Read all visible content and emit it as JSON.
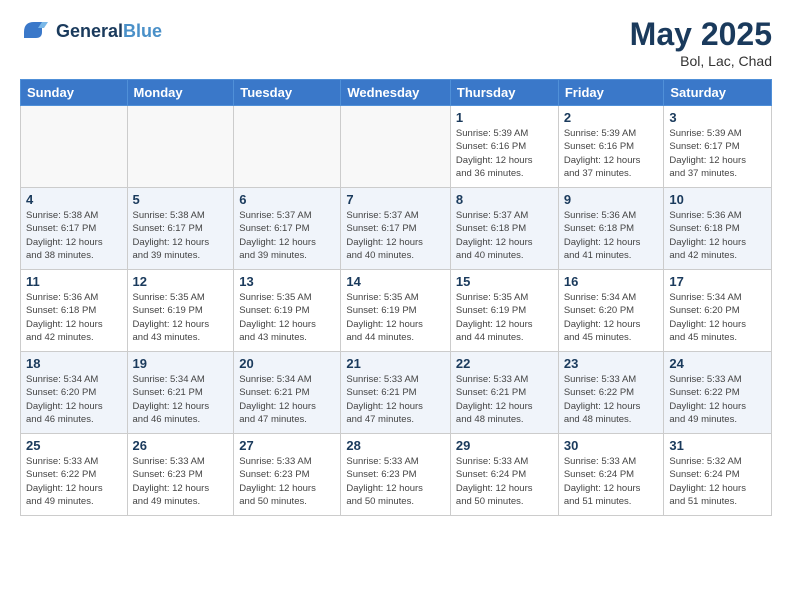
{
  "header": {
    "logo_line1": "General",
    "logo_line2": "Blue",
    "title": "May 2025",
    "subtitle": "Bol, Lac, Chad"
  },
  "days_of_week": [
    "Sunday",
    "Monday",
    "Tuesday",
    "Wednesday",
    "Thursday",
    "Friday",
    "Saturday"
  ],
  "weeks": [
    [
      {
        "day": "",
        "info": ""
      },
      {
        "day": "",
        "info": ""
      },
      {
        "day": "",
        "info": ""
      },
      {
        "day": "",
        "info": ""
      },
      {
        "day": "1",
        "info": "Sunrise: 5:39 AM\nSunset: 6:16 PM\nDaylight: 12 hours\nand 36 minutes."
      },
      {
        "day": "2",
        "info": "Sunrise: 5:39 AM\nSunset: 6:16 PM\nDaylight: 12 hours\nand 37 minutes."
      },
      {
        "day": "3",
        "info": "Sunrise: 5:39 AM\nSunset: 6:17 PM\nDaylight: 12 hours\nand 37 minutes."
      }
    ],
    [
      {
        "day": "4",
        "info": "Sunrise: 5:38 AM\nSunset: 6:17 PM\nDaylight: 12 hours\nand 38 minutes."
      },
      {
        "day": "5",
        "info": "Sunrise: 5:38 AM\nSunset: 6:17 PM\nDaylight: 12 hours\nand 39 minutes."
      },
      {
        "day": "6",
        "info": "Sunrise: 5:37 AM\nSunset: 6:17 PM\nDaylight: 12 hours\nand 39 minutes."
      },
      {
        "day": "7",
        "info": "Sunrise: 5:37 AM\nSunset: 6:17 PM\nDaylight: 12 hours\nand 40 minutes."
      },
      {
        "day": "8",
        "info": "Sunrise: 5:37 AM\nSunset: 6:18 PM\nDaylight: 12 hours\nand 40 minutes."
      },
      {
        "day": "9",
        "info": "Sunrise: 5:36 AM\nSunset: 6:18 PM\nDaylight: 12 hours\nand 41 minutes."
      },
      {
        "day": "10",
        "info": "Sunrise: 5:36 AM\nSunset: 6:18 PM\nDaylight: 12 hours\nand 42 minutes."
      }
    ],
    [
      {
        "day": "11",
        "info": "Sunrise: 5:36 AM\nSunset: 6:18 PM\nDaylight: 12 hours\nand 42 minutes."
      },
      {
        "day": "12",
        "info": "Sunrise: 5:35 AM\nSunset: 6:19 PM\nDaylight: 12 hours\nand 43 minutes."
      },
      {
        "day": "13",
        "info": "Sunrise: 5:35 AM\nSunset: 6:19 PM\nDaylight: 12 hours\nand 43 minutes."
      },
      {
        "day": "14",
        "info": "Sunrise: 5:35 AM\nSunset: 6:19 PM\nDaylight: 12 hours\nand 44 minutes."
      },
      {
        "day": "15",
        "info": "Sunrise: 5:35 AM\nSunset: 6:19 PM\nDaylight: 12 hours\nand 44 minutes."
      },
      {
        "day": "16",
        "info": "Sunrise: 5:34 AM\nSunset: 6:20 PM\nDaylight: 12 hours\nand 45 minutes."
      },
      {
        "day": "17",
        "info": "Sunrise: 5:34 AM\nSunset: 6:20 PM\nDaylight: 12 hours\nand 45 minutes."
      }
    ],
    [
      {
        "day": "18",
        "info": "Sunrise: 5:34 AM\nSunset: 6:20 PM\nDaylight: 12 hours\nand 46 minutes."
      },
      {
        "day": "19",
        "info": "Sunrise: 5:34 AM\nSunset: 6:21 PM\nDaylight: 12 hours\nand 46 minutes."
      },
      {
        "day": "20",
        "info": "Sunrise: 5:34 AM\nSunset: 6:21 PM\nDaylight: 12 hours\nand 47 minutes."
      },
      {
        "day": "21",
        "info": "Sunrise: 5:33 AM\nSunset: 6:21 PM\nDaylight: 12 hours\nand 47 minutes."
      },
      {
        "day": "22",
        "info": "Sunrise: 5:33 AM\nSunset: 6:21 PM\nDaylight: 12 hours\nand 48 minutes."
      },
      {
        "day": "23",
        "info": "Sunrise: 5:33 AM\nSunset: 6:22 PM\nDaylight: 12 hours\nand 48 minutes."
      },
      {
        "day": "24",
        "info": "Sunrise: 5:33 AM\nSunset: 6:22 PM\nDaylight: 12 hours\nand 49 minutes."
      }
    ],
    [
      {
        "day": "25",
        "info": "Sunrise: 5:33 AM\nSunset: 6:22 PM\nDaylight: 12 hours\nand 49 minutes."
      },
      {
        "day": "26",
        "info": "Sunrise: 5:33 AM\nSunset: 6:23 PM\nDaylight: 12 hours\nand 49 minutes."
      },
      {
        "day": "27",
        "info": "Sunrise: 5:33 AM\nSunset: 6:23 PM\nDaylight: 12 hours\nand 50 minutes."
      },
      {
        "day": "28",
        "info": "Sunrise: 5:33 AM\nSunset: 6:23 PM\nDaylight: 12 hours\nand 50 minutes."
      },
      {
        "day": "29",
        "info": "Sunrise: 5:33 AM\nSunset: 6:24 PM\nDaylight: 12 hours\nand 50 minutes."
      },
      {
        "day": "30",
        "info": "Sunrise: 5:33 AM\nSunset: 6:24 PM\nDaylight: 12 hours\nand 51 minutes."
      },
      {
        "day": "31",
        "info": "Sunrise: 5:32 AM\nSunset: 6:24 PM\nDaylight: 12 hours\nand 51 minutes."
      }
    ]
  ]
}
